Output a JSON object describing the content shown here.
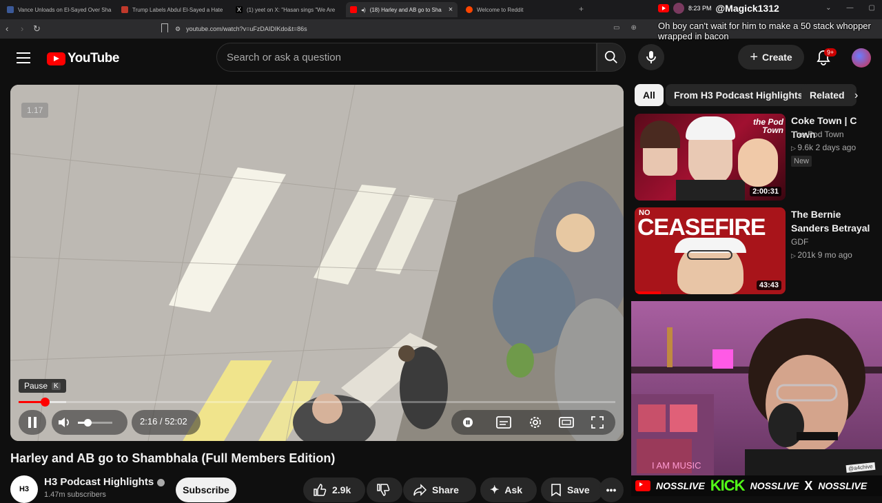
{
  "browser": {
    "tabs": [
      {
        "title": "Vance Unloads on El-Sayed Over Sha",
        "fav_color": "#3b5998"
      },
      {
        "title": "Trump Labels Abdul El-Sayed a Hate",
        "fav_color": "#c0392b"
      },
      {
        "title": "(1) yeet on X: \"Hasan sings \"We Are",
        "fav_color": "#000000"
      },
      {
        "title": "(18) Harley and AB go to Sha",
        "fav_color": "#ff0000"
      },
      {
        "title": "Welcome to Reddit",
        "fav_color": "#ff4500"
      }
    ],
    "active_tab_index": 3,
    "url": "youtube.com/watch?v=uFzDAIDIKdo&t=86s"
  },
  "stream": {
    "time": "8:23 PM",
    "username": "@Magick1312",
    "chat_message": "Oh boy can't wait for him to make a 50 stack whopper wrapped in bacon"
  },
  "youtube": {
    "logo_text": "YouTube",
    "search_placeholder": "Search or ask a question",
    "create_label": "Create",
    "notif_badge": "9+"
  },
  "player": {
    "speed": "1.17",
    "tooltip_label": "Pause",
    "tooltip_key": "K",
    "current_time": "2:16",
    "duration": "52:02",
    "time_display": "2:16 / 52:02",
    "progress_fraction": 0.044,
    "buffer_fraction": 0.08
  },
  "video": {
    "title": "Harley and AB go to Shambhala (Full Members Edition)",
    "channel_logo": "H3",
    "channel": "H3 Podcast Highlights",
    "subscribers": "1.47m subscribers",
    "subscribe_label": "Subscribe",
    "likes": "2.9k",
    "share_label": "Share",
    "ask_label": "Ask",
    "save_label": "Save"
  },
  "chips": [
    "All",
    "From H3 Podcast Highlights",
    "Related"
  ],
  "recommendations": [
    {
      "title": "Coke Town | C Town",
      "channel": "The Pod Town",
      "stats": "9.6k  2 days ago",
      "badge": "New",
      "duration": "2:00:31",
      "thumb_text": "the Pod Town"
    },
    {
      "title": "The Bernie Sanders Betrayal",
      "channel": "GDF",
      "stats": "201k  9 mo ago",
      "duration": "43:43",
      "thumb_text": "CEASEFIRE",
      "thumb_text_small": "NO"
    }
  ],
  "overlay": {
    "items": [
      "NOSSLIVE",
      "KICK",
      "NOSSLIVE",
      "NOSSLIVE"
    ],
    "handle": "@a4chive"
  }
}
